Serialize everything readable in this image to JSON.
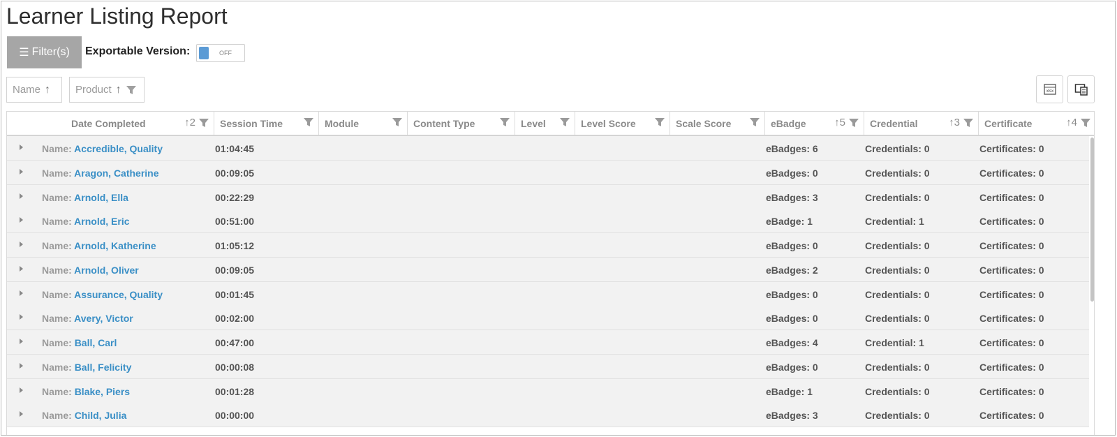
{
  "page": {
    "title": "Learner Listing Report"
  },
  "toolbar": {
    "filter_label": "Filter(s)",
    "export_label": "Exportable Version:",
    "toggle_state": "OFF"
  },
  "chips": {
    "name_label": "Name",
    "product_label": "Product"
  },
  "columns": {
    "date_completed": {
      "label": "Date Completed",
      "sort": "2"
    },
    "session_time": {
      "label": "Session Time"
    },
    "module": {
      "label": "Module"
    },
    "content_type": {
      "label": "Content Type"
    },
    "level": {
      "label": "Level"
    },
    "level_score": {
      "label": "Level Score"
    },
    "scale_score": {
      "label": "Scale Score"
    },
    "ebadge": {
      "label": "eBadge",
      "sort": "5"
    },
    "credential": {
      "label": "Credential",
      "sort": "3"
    },
    "certificate": {
      "label": "Certificate",
      "sort": "4"
    }
  },
  "row_name_prefix": "Name:",
  "rows": [
    {
      "name": "Accredible, Quality",
      "session": "01:04:45",
      "ebadge": "eBadges: 6",
      "credential": "Credentials: 0",
      "certificate": "Certificates: 0"
    },
    {
      "name": "Aragon, Catherine",
      "session": "00:09:05",
      "ebadge": "eBadges: 0",
      "credential": "Credentials: 0",
      "certificate": "Certificates: 0"
    },
    {
      "name": "Arnold, Ella",
      "session": "00:22:29",
      "ebadge": "eBadges: 3",
      "credential": "Credentials: 0",
      "certificate": "Certificates: 0"
    },
    {
      "name": "Arnold, Eric",
      "session": "00:51:00",
      "ebadge": "eBadge: 1",
      "credential": "Credential: 1",
      "certificate": "Certificates: 0"
    },
    {
      "name": "Arnold, Katherine",
      "session": "01:05:12",
      "ebadge": "eBadges: 0",
      "credential": "Credentials: 0",
      "certificate": "Certificates: 0"
    },
    {
      "name": "Arnold, Oliver",
      "session": "00:09:05",
      "ebadge": "eBadges: 2",
      "credential": "Credentials: 0",
      "certificate": "Certificates: 0"
    },
    {
      "name": "Assurance, Quality",
      "session": "00:01:45",
      "ebadge": "eBadges: 0",
      "credential": "Credentials: 0",
      "certificate": "Certificates: 0"
    },
    {
      "name": "Avery, Victor",
      "session": "00:02:00",
      "ebadge": "eBadges: 0",
      "credential": "Credentials: 0",
      "certificate": "Certificates: 0"
    },
    {
      "name": "Ball, Carl",
      "session": "00:47:00",
      "ebadge": "eBadges: 4",
      "credential": "Credential: 1",
      "certificate": "Certificates: 0"
    },
    {
      "name": "Ball, Felicity",
      "session": "00:00:08",
      "ebadge": "eBadges: 0",
      "credential": "Credentials: 0",
      "certificate": "Certificates: 0"
    },
    {
      "name": "Blake, Piers",
      "session": "00:01:28",
      "ebadge": "eBadge: 1",
      "credential": "Credentials: 0",
      "certificate": "Certificates: 0"
    },
    {
      "name": "Child, Julia",
      "session": "00:00:00",
      "ebadge": "eBadges: 3",
      "credential": "Credentials: 0",
      "certificate": "Certificates: 0"
    }
  ],
  "colors": {
    "link": "#3a8fc6",
    "filter_button": "#a6a6a6",
    "toggle_knob": "#5b9bd5",
    "row_bg": "#f2f2f2"
  },
  "icons": {
    "filter_button": "hamburger-icon",
    "column_filter": "funnel-icon",
    "sort": "sort-up-arrow-icon",
    "export": "xlsx-export-icon",
    "columns": "column-chooser-icon"
  }
}
